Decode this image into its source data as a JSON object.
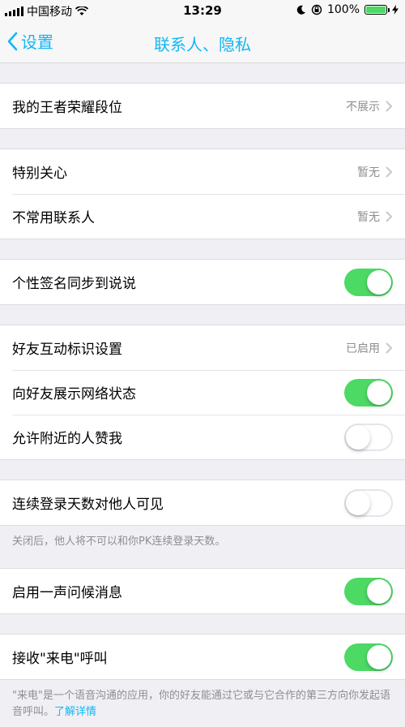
{
  "status_bar": {
    "carrier": "中国移动",
    "time": "13:29",
    "battery": "100%"
  },
  "nav": {
    "back_label": "设置",
    "title": "联系人、隐私"
  },
  "rows": {
    "rank": {
      "label": "我的王者荣耀段位",
      "value": "不展示"
    },
    "special_care": {
      "label": "特别关心",
      "value": "暂无"
    },
    "uncommon_contacts": {
      "label": "不常用联系人",
      "value": "暂无"
    },
    "signature_sync": {
      "label": "个性签名同步到说说",
      "state": true
    },
    "interaction_mark": {
      "label": "好友互动标识设置",
      "value": "已启用"
    },
    "network_status": {
      "label": "向好友展示网络状态",
      "state": true
    },
    "nearby_like": {
      "label": "允许附近的人赞我",
      "state": false
    },
    "login_days": {
      "label": "连续登录天数对他人可见",
      "state": false
    },
    "greeting": {
      "label": "启用一声问候消息",
      "state": true
    },
    "call": {
      "label": "接收\"来电\"呼叫",
      "state": true
    }
  },
  "notes": {
    "login_days": "关闭后，他人将不可以和你PK连续登录天数。",
    "call": "\"来电\"是一个语音沟通的应用，你的好友能通过它或与它合作的第三方向你发起语音呼叫。",
    "call_link": "了解详情"
  },
  "icons": {
    "back": "chevron-left-icon",
    "disclosure": "chevron-right-icon",
    "wifi": "wifi-icon",
    "moon": "moon-icon",
    "lock": "orientation-lock-icon",
    "battery": "battery-icon",
    "charging": "charging-bolt-icon"
  },
  "colors": {
    "accent": "#12b7f5",
    "toggle_on": "#4cd964",
    "background": "#efeff4"
  }
}
